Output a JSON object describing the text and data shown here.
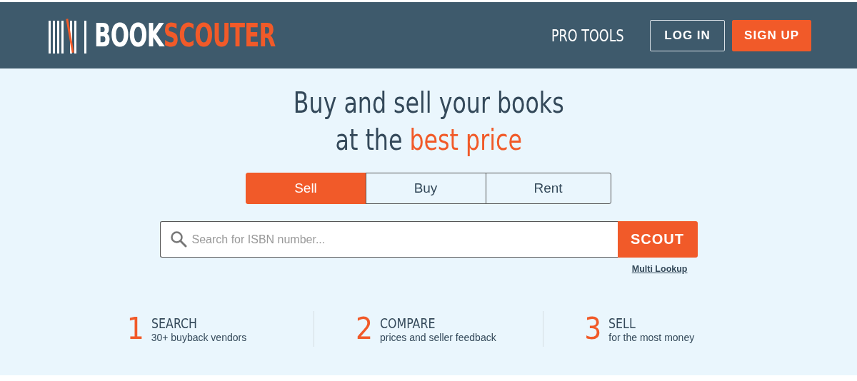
{
  "header": {
    "logo": {
      "first": "BOOK",
      "second": "SCOUTER"
    },
    "nav": [
      {
        "kind": "link",
        "label": "PRO TOOLS"
      },
      {
        "kind": "outline",
        "label": "LOG IN"
      },
      {
        "kind": "filled",
        "label": "SIGN UP"
      }
    ]
  },
  "hero": {
    "line1": "Buy and sell your books",
    "line2": "at the ",
    "highlight": "best price"
  },
  "tabs": [
    {
      "label": "Sell",
      "selected": true
    },
    {
      "label": "Buy",
      "selected": false
    },
    {
      "label": "Rent",
      "selected": false
    }
  ],
  "search": {
    "placeholder": "Search for ISBN number...",
    "button": "SCOUT",
    "link": "Multi Lookup"
  },
  "steps": [
    {
      "number": "1",
      "title": "SEARCH",
      "text": "30+ buyback vendors"
    },
    {
      "number": "2",
      "title": "COMPARE",
      "text": "prices and seller feedback"
    },
    {
      "number": "3",
      "title": "SELL",
      "text": "for the most money"
    }
  ]
}
